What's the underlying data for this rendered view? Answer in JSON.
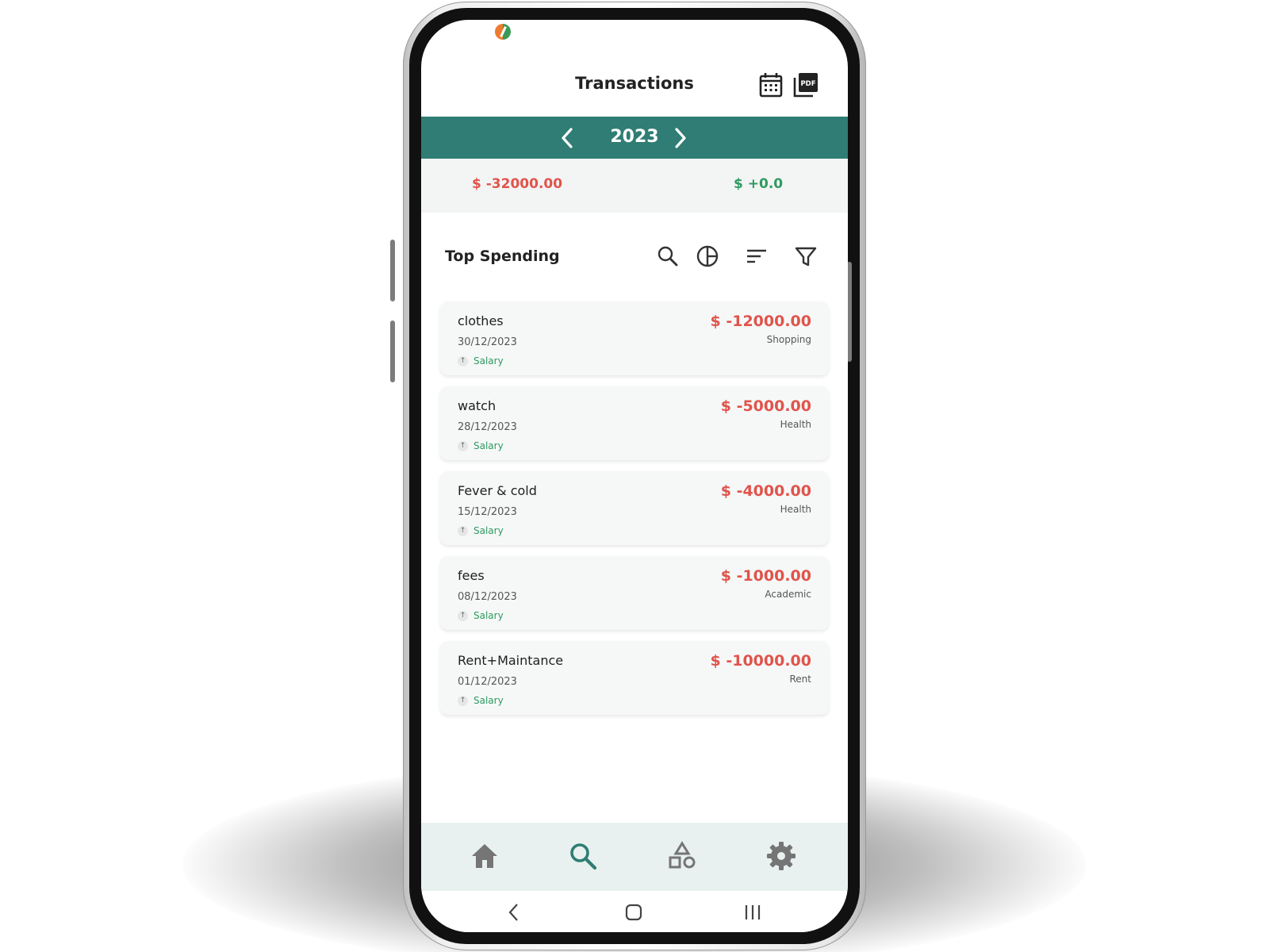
{
  "header": {
    "title": "Transactions",
    "calendar_icon": "calendar-icon",
    "pdf_icon": "pdf-export-icon",
    "pdf_icon_text": "PDF"
  },
  "year_selector": {
    "year": "2023",
    "prev_icon": "chevron-left-icon",
    "next_icon": "chevron-right-icon"
  },
  "totals": {
    "expense": "$ -32000.00",
    "income": "$ +0.0"
  },
  "section": {
    "title": "Top Spending",
    "tools": [
      "search-icon",
      "pie-chart-icon",
      "sort-icon",
      "filter-icon"
    ]
  },
  "transactions": [
    {
      "name": "clothes",
      "date": "30/12/2023",
      "account": "Salary",
      "amount": "$ -12000.00",
      "category": "Shopping"
    },
    {
      "name": "watch",
      "date": "28/12/2023",
      "account": "Salary",
      "amount": "$ -5000.00",
      "category": "Health"
    },
    {
      "name": "Fever & cold",
      "date": "15/12/2023",
      "account": "Salary",
      "amount": "$ -4000.00",
      "category": "Health"
    },
    {
      "name": "fees",
      "date": "08/12/2023",
      "account": "Salary",
      "amount": "$ -1000.00",
      "category": "Academic"
    },
    {
      "name": "Rent+Maintance",
      "date": "01/12/2023",
      "account": "Salary",
      "amount": "$ -10000.00",
      "category": "Rent"
    }
  ],
  "bottom_nav": {
    "items": [
      "home-icon",
      "search-icon",
      "categories-icon",
      "settings-icon"
    ],
    "active": "search-icon"
  },
  "system_nav": [
    "back-icon",
    "home-button-icon",
    "recents-icon"
  ],
  "colors": {
    "accent": "#2f7d74",
    "expense": "#e0544b",
    "income": "#2e9a60",
    "nav_bg": "#e8f1ef"
  }
}
